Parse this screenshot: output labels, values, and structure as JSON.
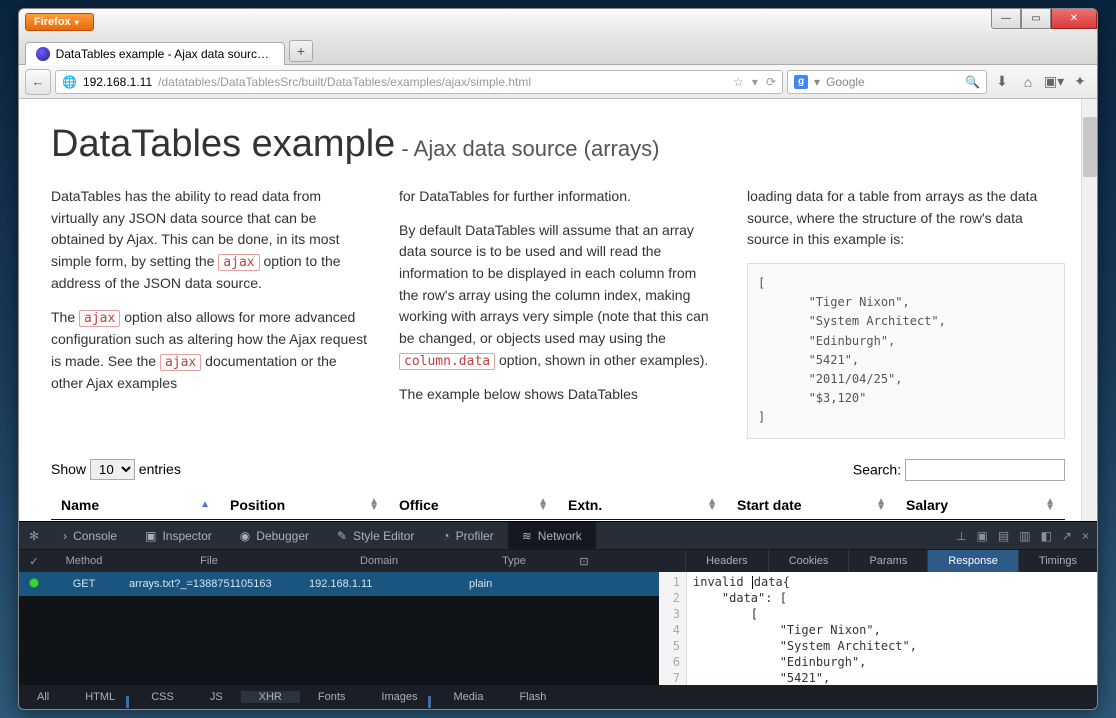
{
  "browser": {
    "firefox_label": "Firefox",
    "tab_title": "DataTables example - Ajax data source (...",
    "url_host": "192.168.1.11",
    "url_path": "/datatables/DataTablesSrc/built/DataTables/examples/ajax/simple.html",
    "search_placeholder": "Google"
  },
  "page": {
    "heading_main": "DataTables example",
    "heading_sub": " - Ajax data source (arrays)",
    "col1_p1a": "DataTables has the ability to read data from virtually any JSON data source that can be obtained by Ajax. This can be done, in its most simple form, by setting the ",
    "col1_code1": "ajax",
    "col1_p1b": " option to the address of the JSON data source.",
    "col1_p2a": "The ",
    "col1_code2": "ajax",
    "col1_p2b": " option also allows for more advanced configuration such as altering how the Ajax request is made. See the ",
    "col1_code3": "ajax",
    "col1_p2c": " documentation or the other Ajax examples",
    "col2_p1": "for DataTables for further information.",
    "col2_p2a": "By default DataTables will assume that an array data source is to be used and will read the information to be displayed in each column from the row's array using the column index, making working with arrays very simple (note that this can be changed, or objects used may using the ",
    "col2_code1": "column.data",
    "col2_p2b": " option, shown in other examples).",
    "col2_p3": "The example below shows DataTables",
    "col3_p1": "loading data for a table from arrays as the data source, where the structure of the row's data source in this example is:",
    "example_block": "[\n       \"Tiger Nixon\",\n       \"System Architect\",\n       \"Edinburgh\",\n       \"5421\",\n       \"2011/04/25\",\n       \"$3,120\"\n]",
    "show_label_a": "Show ",
    "show_value": "10",
    "show_label_b": " entries",
    "search_label": "Search:",
    "th": [
      "Name",
      "Position",
      "Office",
      "Extn.",
      "Start date",
      "Salary"
    ]
  },
  "devtools": {
    "tabs": {
      "console": "Console",
      "inspector": "Inspector",
      "debugger": "Debugger",
      "style": "Style Editor",
      "profiler": "Profiler",
      "network": "Network"
    },
    "columns": {
      "method": "Method",
      "file": "File",
      "domain": "Domain",
      "type": "Type"
    },
    "detail_tabs": {
      "headers": "Headers",
      "cookies": "Cookies",
      "params": "Params",
      "response": "Response",
      "timings": "Timings"
    },
    "row": {
      "method": "GET",
      "file": "arrays.txt?_=1388751105163",
      "domain": "192.168.1.11",
      "type": "plain"
    },
    "response_lines": [
      "invalid data{",
      "    \"data\": [",
      "        [",
      "            \"Tiger Nixon\",",
      "            \"System Architect\",",
      "            \"Edinburgh\",",
      "            \"5421\","
    ],
    "filters": {
      "all": "All",
      "html": "HTML",
      "css": "CSS",
      "js": "JS",
      "xhr": "XHR",
      "fonts": "Fonts",
      "images": "Images",
      "media": "Media",
      "flash": "Flash"
    }
  }
}
